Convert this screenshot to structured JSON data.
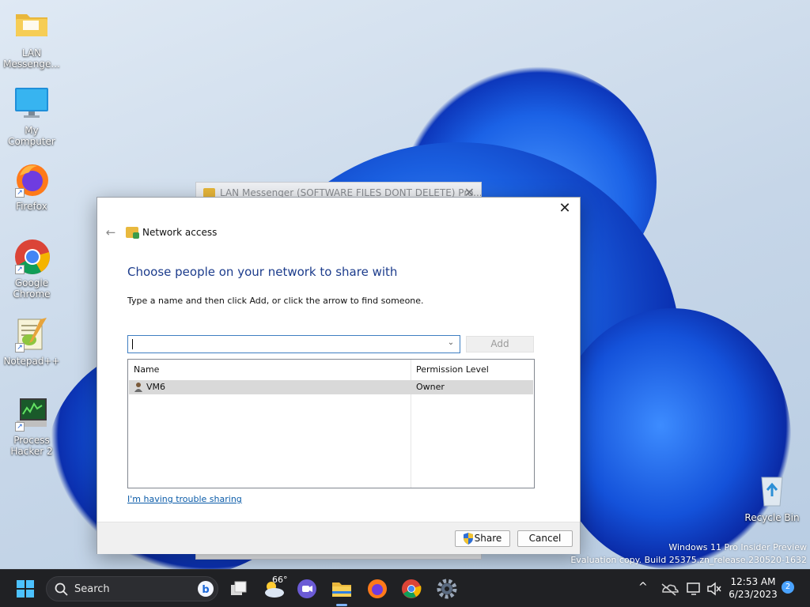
{
  "desktop": {
    "icons": [
      {
        "label": "LAN Messenge...",
        "icon": "folder-icon"
      },
      {
        "label": "My Computer",
        "icon": "monitor-icon"
      },
      {
        "label": "Firefox",
        "icon": "firefox-icon"
      },
      {
        "label": "Google Chrome",
        "icon": "chrome-icon"
      },
      {
        "label": "Notepad++",
        "icon": "notepadpp-icon"
      },
      {
        "label": "Process Hacker 2",
        "icon": "process-hacker-icon"
      },
      {
        "label": "Recycle Bin",
        "icon": "recycle-bin-icon"
      }
    ],
    "watermark_line1": "Windows 11 Pro Insider Preview",
    "watermark_line2": "Evaluation copy. Build 25375.zn_release.230520-1632"
  },
  "background_window": {
    "title": "LAN Messenger (SOFTWARE FILES DONT  DELETE) Pro..."
  },
  "dialog": {
    "header_title": "Network access",
    "heading": "Choose people on your network to share with",
    "instruction": "Type a name and then click Add, or click the arrow to find someone.",
    "name_input": {
      "value": "",
      "placeholder": ""
    },
    "add_label": "Add",
    "columns": [
      "Name",
      "Permission Level"
    ],
    "rows": [
      {
        "name": "VM6",
        "permission": "Owner"
      }
    ],
    "trouble_link": "I'm having trouble sharing",
    "share_label": "Share",
    "cancel_label": "Cancel"
  },
  "taskbar": {
    "search_label": "Search",
    "weather_temp": "66°",
    "time": "12:53 AM",
    "date": "6/23/2023",
    "notification_count": "2"
  },
  "colors": {
    "accent": "#1c3c8c",
    "link": "#0a5ba8",
    "taskbar": "#202124"
  }
}
